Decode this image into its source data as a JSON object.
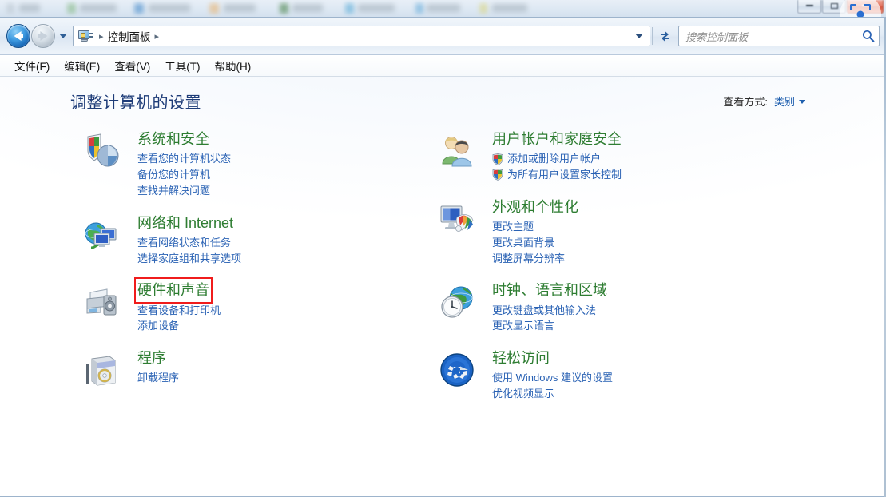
{
  "window": {
    "caption_buttons": [
      {
        "name": "minimize",
        "glyph": "minimize-glyph"
      },
      {
        "name": "maximize",
        "glyph": "maximize-glyph"
      },
      {
        "name": "close",
        "glyph": "close-glyph"
      }
    ]
  },
  "navbar": {
    "back_tooltip": "后退",
    "forward_tooltip": "前进",
    "breadcrumb": [
      "控制面板"
    ],
    "breadcrumb_separator": "▸",
    "refresh_tooltip": "刷新"
  },
  "search": {
    "placeholder": "搜索控制面板",
    "value": ""
  },
  "menubar": {
    "items": [
      {
        "label": "文件(F)"
      },
      {
        "label": "编辑(E)"
      },
      {
        "label": "查看(V)"
      },
      {
        "label": "工具(T)"
      },
      {
        "label": "帮助(H)"
      }
    ]
  },
  "main": {
    "heading": "调整计算机的设置",
    "view_mode_label": "查看方式:",
    "view_mode_value": "类别"
  },
  "colors": {
    "heading": "#1e3c78",
    "category_title": "#2e7d32",
    "link": "#2a62b4",
    "highlight_box": "#f01c1c"
  },
  "categories": {
    "left": [
      {
        "title": "系统和安全",
        "icon": "security-shield-icon",
        "highlighted": false,
        "links": [
          {
            "label": "查看您的计算机状态",
            "shield": false
          },
          {
            "label": "备份您的计算机",
            "shield": false
          },
          {
            "label": "查找并解决问题",
            "shield": false
          }
        ]
      },
      {
        "title": "网络和 Internet",
        "icon": "network-globe-icon",
        "highlighted": false,
        "links": [
          {
            "label": "查看网络状态和任务",
            "shield": false
          },
          {
            "label": "选择家庭组和共享选项",
            "shield": false
          }
        ]
      },
      {
        "title": "硬件和声音",
        "icon": "printer-speaker-icon",
        "highlighted": true,
        "links": [
          {
            "label": "查看设备和打印机",
            "shield": false
          },
          {
            "label": "添加设备",
            "shield": false
          }
        ]
      },
      {
        "title": "程序",
        "icon": "software-box-icon",
        "highlighted": false,
        "links": [
          {
            "label": "卸载程序",
            "shield": false
          }
        ]
      }
    ],
    "right": [
      {
        "title": "用户帐户和家庭安全",
        "icon": "users-icon",
        "highlighted": false,
        "links": [
          {
            "label": "添加或删除用户帐户",
            "shield": true
          },
          {
            "label": "为所有用户设置家长控制",
            "shield": true
          }
        ]
      },
      {
        "title": "外观和个性化",
        "icon": "monitor-palette-icon",
        "highlighted": false,
        "links": [
          {
            "label": "更改主题",
            "shield": false
          },
          {
            "label": "更改桌面背景",
            "shield": false
          },
          {
            "label": "调整屏幕分辨率",
            "shield": false
          }
        ]
      },
      {
        "title": "时钟、语言和区域",
        "icon": "clock-globe-icon",
        "highlighted": false,
        "links": [
          {
            "label": "更改键盘或其他输入法",
            "shield": false
          },
          {
            "label": "更改显示语言",
            "shield": false
          }
        ]
      },
      {
        "title": "轻松访问",
        "icon": "ease-of-access-icon",
        "highlighted": false,
        "links": [
          {
            "label": "使用 Windows 建议的设置",
            "shield": false
          },
          {
            "label": "优化视频显示",
            "shield": false
          }
        ]
      }
    ]
  }
}
